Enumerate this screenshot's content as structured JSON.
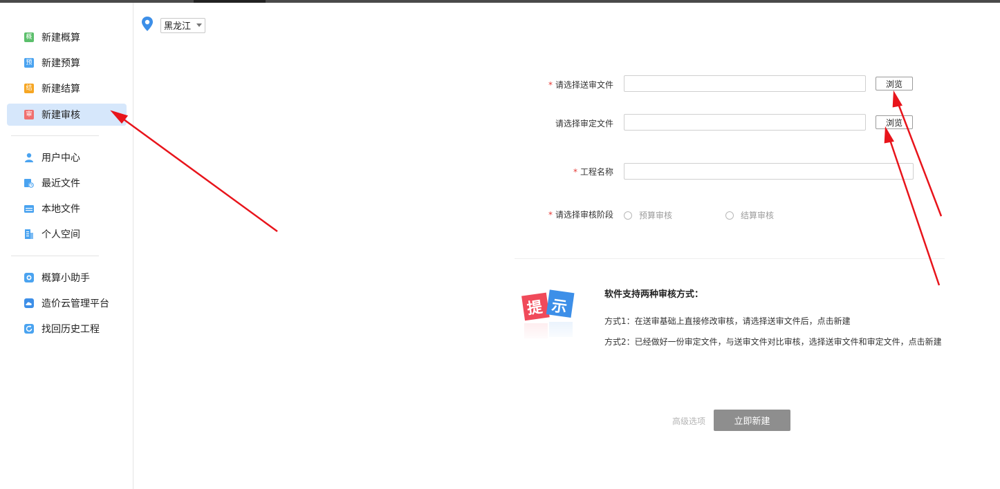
{
  "location": {
    "selected": "黑龙江"
  },
  "sidebar": {
    "group1": [
      {
        "label": "新建概算",
        "icon": "概",
        "color": "#5bbf6b"
      },
      {
        "label": "新建预算",
        "icon": "预",
        "color": "#4aa3f0"
      },
      {
        "label": "新建结算",
        "icon": "结",
        "color": "#f6a623"
      },
      {
        "label": "新建审核",
        "icon": "审",
        "color": "#f07070"
      }
    ],
    "group2": [
      {
        "label": "用户中心"
      },
      {
        "label": "最近文件"
      },
      {
        "label": "本地文件"
      },
      {
        "label": "个人空间"
      }
    ],
    "group3": [
      {
        "label": "概算小助手"
      },
      {
        "label": "造价云管理平台"
      },
      {
        "label": "找回历史工程"
      }
    ]
  },
  "form": {
    "submit_file_label": "请选择送审文件",
    "approved_file_label": "请选择审定文件",
    "project_name_label": "工程名称",
    "stage_label": "请选择审核阶段",
    "browse_label": "浏览",
    "required_mark": "*",
    "stage_options": [
      "预算审核",
      "结算审核"
    ]
  },
  "hint": {
    "badge_chars": [
      "提",
      "示"
    ],
    "title": "软件支持两种审核方式：",
    "line1": "方式1：在送审基础上直接修改审核，请选择送审文件后，点击新建",
    "line2": "方式2：已经做好一份审定文件，与送审文件对比审核，选择送审文件和审定文件，点击新建"
  },
  "actions": {
    "advanced_label": "高级选项",
    "create_label": "立即新建"
  },
  "colors": {
    "active_bg": "#d6e7fb",
    "annotation_arrow": "#e8141b",
    "primary_disabled": "#8e8e8e"
  }
}
